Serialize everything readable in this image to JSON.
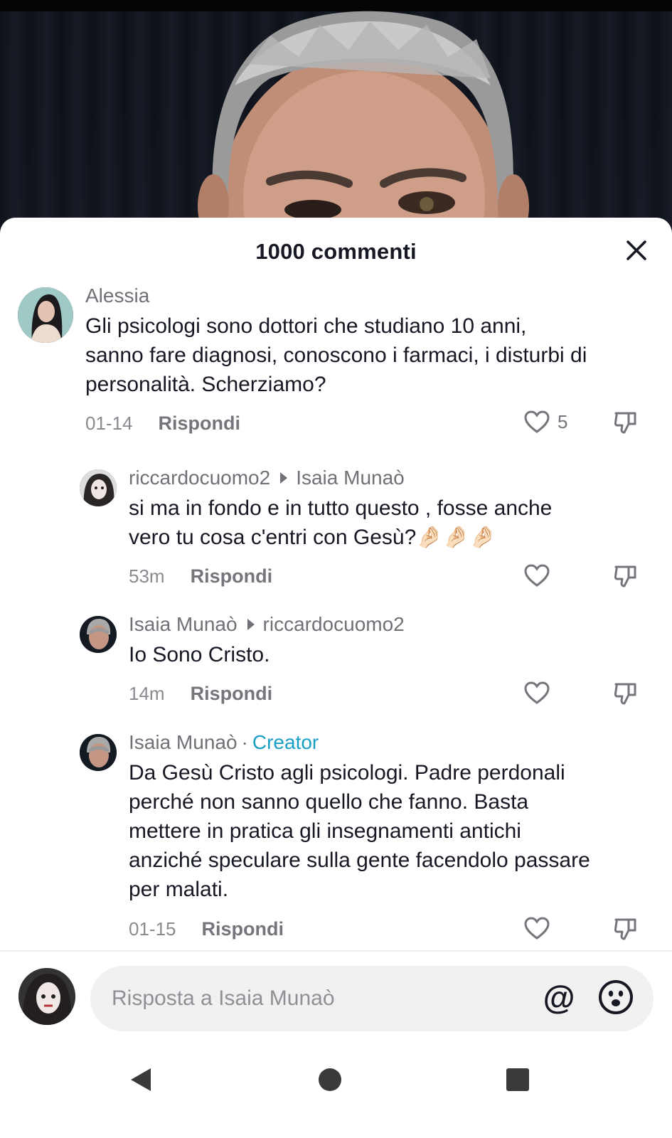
{
  "sheet": {
    "title": "1000 commenti"
  },
  "comments": [
    {
      "author": "Alessia",
      "text_lines": [
        "Gli psicologi sono dottori che studiano 10 anni,",
        "sanno fare diagnosi, conoscono i farmaci, i disturbi di",
        "personalità. Scherziamo?"
      ],
      "date": "01-14",
      "reply_label": "Rispondi",
      "likes": "5"
    },
    {
      "author": "riccardocuomo2",
      "reply_to": "Isaia Munaò",
      "text_lines": [
        "si ma in fondo e in tutto questo , fosse anche",
        "vero tu cosa c'entri con Gesù?🤌🏻🤌🏻🤌🏻"
      ],
      "date": "53m",
      "reply_label": "Rispondi"
    },
    {
      "author": "Isaia Munaò",
      "reply_to": "riccardocuomo2",
      "text_lines": [
        "Io Sono Cristo."
      ],
      "date": "14m",
      "reply_label": "Rispondi"
    },
    {
      "author": "Isaia Munaò",
      "badge": "Creator",
      "separator": "·",
      "text_lines": [
        "Da Gesù Cristo agli psicologi. Padre perdonali",
        "perché non sanno quello che fanno. Basta",
        "mettere in pratica gli insegnamenti antichi",
        "anziché speculare sulla gente facendolo passare",
        "per malati."
      ],
      "date": "01-15",
      "reply_label": "Rispondi"
    }
  ],
  "input": {
    "placeholder": "Risposta a Isaia Munaò",
    "at_symbol": "@"
  },
  "icons": {
    "close": "close-icon",
    "like": "heart-icon",
    "dislike": "thumbs-down-icon",
    "emoji": "smiley-icon",
    "back": "back-triangle-icon",
    "home": "home-circle-icon",
    "recent": "recent-square-icon"
  },
  "colors": {
    "creator_badge": "#1a9fc4",
    "text": "#161823",
    "muted": "#75767c"
  }
}
